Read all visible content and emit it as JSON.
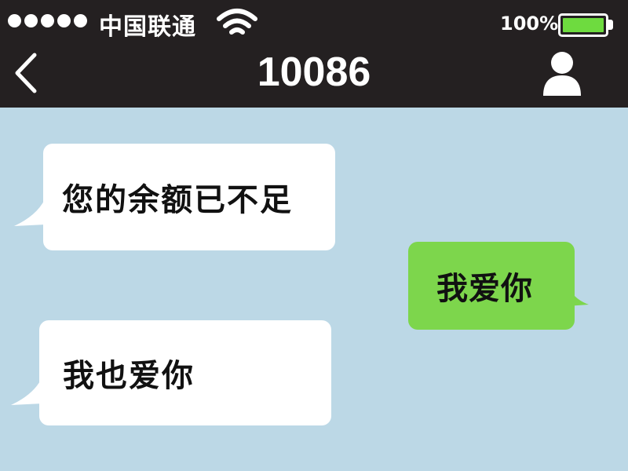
{
  "status_bar": {
    "signal_dot_count": 5,
    "carrier": "中国联通",
    "battery_percent_label": "100%",
    "battery_level": 1.0,
    "wifi_icon": "wifi-icon"
  },
  "nav": {
    "back_icon": "chevron-left-icon",
    "title": "10086",
    "contact_icon": "person-icon"
  },
  "messages": [
    {
      "direction": "incoming",
      "text": "您的余额已不足"
    },
    {
      "direction": "outgoing",
      "text": "我爱你"
    },
    {
      "direction": "incoming",
      "text": "我也爱你"
    }
  ],
  "colors": {
    "header_bg": "#242021",
    "chat_bg": "#bcd8e6",
    "incoming_bubble": "#ffffff",
    "outgoing_bubble": "#7dd64c",
    "battery_fill": "#6edb3f"
  }
}
